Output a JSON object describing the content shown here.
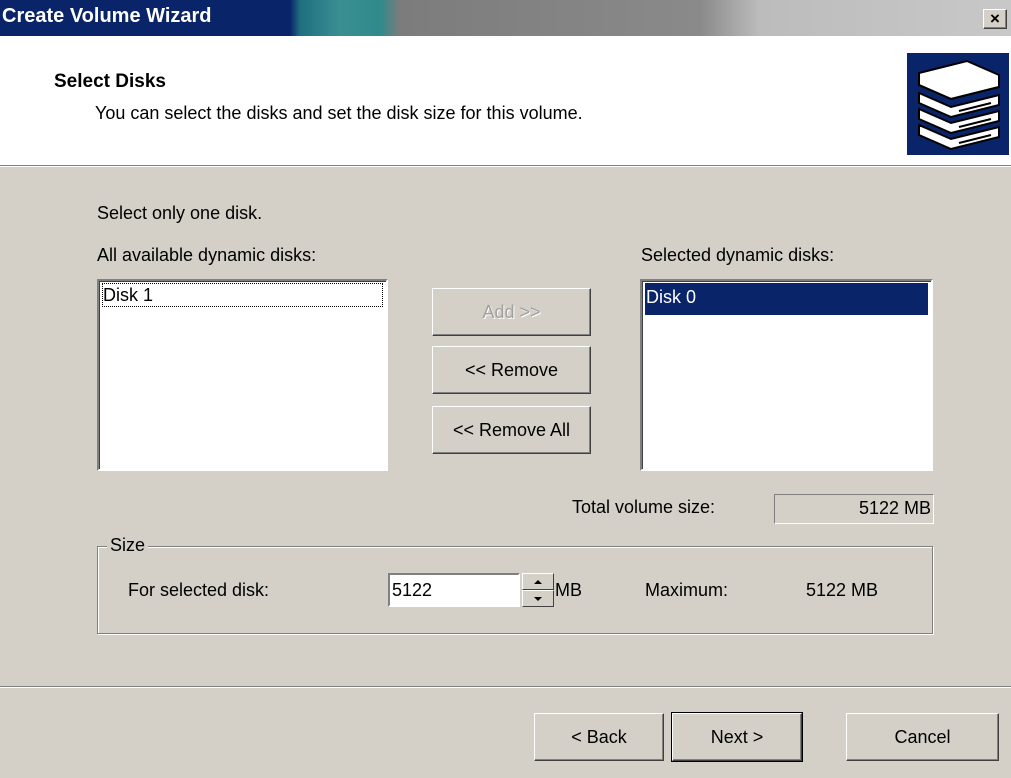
{
  "window": {
    "title": "Create Volume Wizard",
    "close_label": "×"
  },
  "header": {
    "title": "Select Disks",
    "subtitle": "You can select the disks and set the disk size for this volume.",
    "icon": "disk-stack-icon"
  },
  "body": {
    "instruction": "Select only one disk.",
    "available": {
      "label": "All available dynamic disks:",
      "items": [
        "Disk 1"
      ]
    },
    "selected": {
      "label": "Selected dynamic disks:",
      "items": [
        "Disk 0"
      ]
    },
    "buttons": {
      "add": "Add >>",
      "remove": "<< Remove",
      "remove_all": "<< Remove All"
    },
    "total": {
      "label": "Total volume size:",
      "value": "5122 MB"
    },
    "size": {
      "group_label": "Size",
      "field_label": "For selected disk:",
      "value": "5122",
      "unit": "MB",
      "max_label": "Maximum:",
      "max_value": "5122 MB"
    }
  },
  "footer": {
    "back": "< Back",
    "next": "Next >",
    "cancel": "Cancel"
  },
  "colors": {
    "selection": "#0a246a",
    "face": "#d4d0c8"
  }
}
